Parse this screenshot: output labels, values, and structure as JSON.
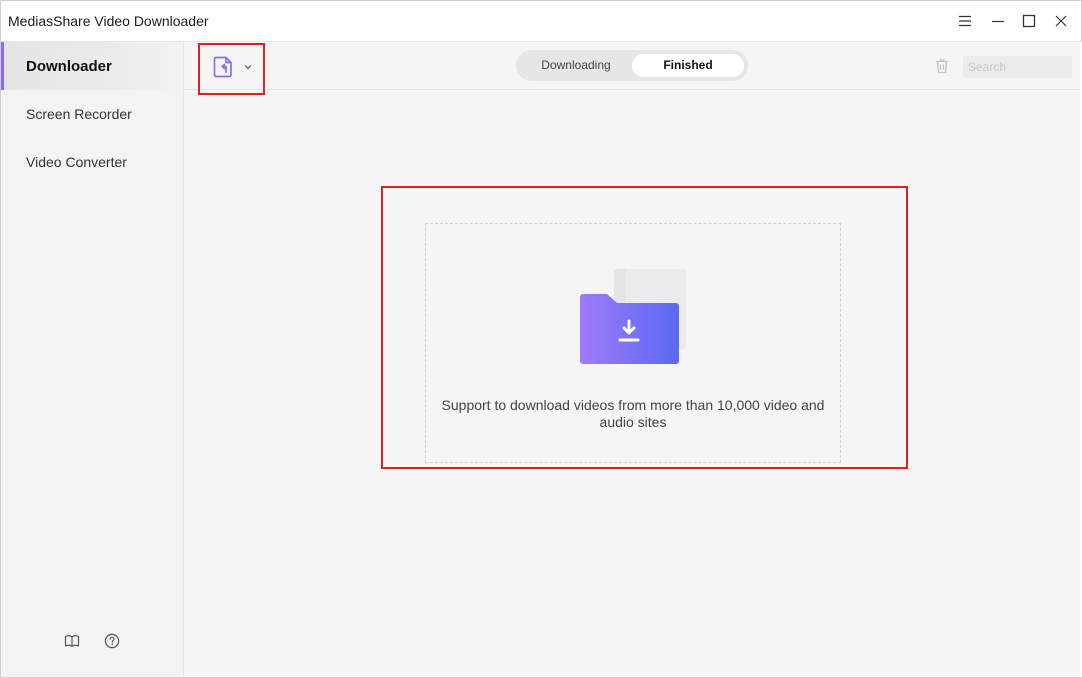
{
  "window": {
    "title": "MediasShare Video Downloader",
    "controls": [
      "menu-icon",
      "minimize-icon",
      "maximize-icon",
      "close-icon"
    ]
  },
  "sidebar": {
    "items": [
      {
        "label": "Downloader",
        "active": true
      },
      {
        "label": "Screen Recorder",
        "active": false
      },
      {
        "label": "Video Converter",
        "active": false
      }
    ],
    "footer_icons": [
      "book-icon",
      "help-icon"
    ]
  },
  "toolbar": {
    "paste_icon": "paste-url-icon",
    "dropdown_icon": "chevron-down-icon",
    "tabs": {
      "downloading": "Downloading",
      "finished": "Finished",
      "active": "finished"
    },
    "delete_icon": "trash-icon",
    "search": {
      "placeholder": "Search",
      "value": ""
    }
  },
  "content": {
    "empty_icon": "download-folder-icon",
    "message_line1": "Support to download videos from more than 10,000 video and",
    "message_line2": "audio sites"
  },
  "colors": {
    "accent": "#8b6cf2",
    "folder_start": "#a07af8",
    "folder_end": "#5a68f4",
    "highlight_border": "#e02020"
  }
}
